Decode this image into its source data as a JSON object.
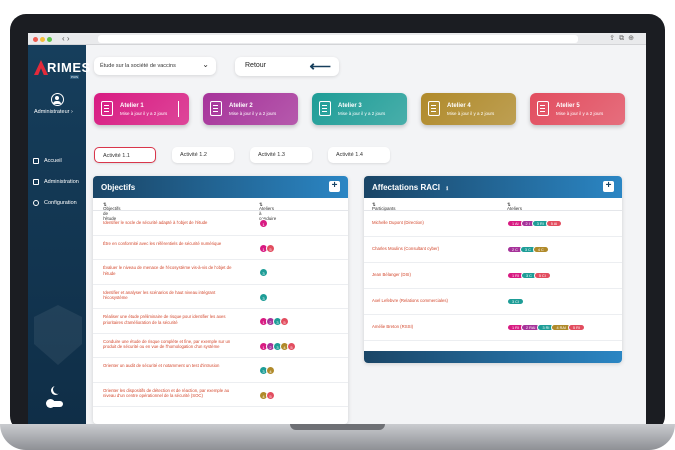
{
  "brand": {
    "name": "RIMES",
    "sub": "PUIS"
  },
  "colors": {
    "sidebar": "#163e5c",
    "accent": "#2b86c4",
    "danger": "#d9364b"
  },
  "sidebar": {
    "role": "Administrateur ›",
    "items": [
      {
        "label": "Accueil",
        "icon": "home-icon"
      },
      {
        "label": "Administration",
        "icon": "admin-icon"
      },
      {
        "label": "Configuration",
        "icon": "gear-icon"
      }
    ]
  },
  "study_select": {
    "value": "Étude sur la société de vaccins",
    "icon": "chevron-down-icon"
  },
  "back_button": {
    "label": "Retour",
    "icon": "arrow-left-icon"
  },
  "ateliers": [
    {
      "title": "Atelier 1",
      "subtitle": "Mise à jour il y a 2 jours",
      "color": "#d81b82"
    },
    {
      "title": "Atelier 2",
      "subtitle": "Mise à jour il y a 2 jours",
      "color": "#a6339a"
    },
    {
      "title": "Atelier 3",
      "subtitle": "Mise à jour il y a 2 jours",
      "color": "#1e9d97"
    },
    {
      "title": "Atelier 4",
      "subtitle": "Mise à jour il y a 2 jours",
      "color": "#b08a2a"
    },
    {
      "title": "Atelier 5",
      "subtitle": "Mise à jour il y a 2 jours",
      "color": "#e24d5f"
    }
  ],
  "activities": [
    "Activité 1.1",
    "Activité 1.2",
    "Activité 1.3",
    "Activité 1.4"
  ],
  "objectifs": {
    "title": "Objectifs",
    "col1": "Objectifs de l'étude",
    "col2": "Ateliers à conduire",
    "rows": [
      {
        "text": "Identifier le socle de sécurité adapté à l'objet de l'étude",
        "tags": [
          "1"
        ]
      },
      {
        "text": "Être en conformité avec les référentiels de sécurité numérique",
        "tags": [
          "1",
          "5"
        ]
      },
      {
        "text": "Évaluer le niveau de menace de l'écosystème vis-à-vis de l'objet de l'étude",
        "tags": [
          "3"
        ]
      },
      {
        "text": "Identifier et analyser les scénarios de haut niveau intégrant l'écosystème",
        "tags": [
          "3"
        ]
      },
      {
        "text": "Réaliser une étude préliminaire de risque pour identifier les axes prioritaires d'amélioration de la sécurité",
        "tags": [
          "1",
          "2",
          "3",
          "5"
        ]
      },
      {
        "text": "Conduire une étude de risque complète et fine, par exemple sur un produit de sécurité ou en vue de l'homologation d'un système",
        "tags": [
          "1",
          "2",
          "3",
          "4",
          "5"
        ]
      },
      {
        "text": "Orienter un audit de sécurité et notamment un test d'intrusion",
        "tags": [
          "3",
          "4"
        ]
      },
      {
        "text": "Orienter les dispositifs de détection et de réaction, par exemple au niveau d'un centre opérationnel de la sécurité (SOC)",
        "tags": [
          "4",
          "5"
        ]
      }
    ]
  },
  "raci": {
    "title": "Affectations RACI",
    "info_icon": "info-icon",
    "col1": "Participants",
    "col2": "Ateliers",
    "rows": [
      {
        "name": "Michelle Dupont (Direction)",
        "tags": [
          "1 AI",
          "2 I",
          "3 RI",
          "5 AI"
        ]
      },
      {
        "name": "Charles Moulins (Consultant cyber)",
        "tags": [
          "2 C",
          "3 C",
          "4 C"
        ]
      },
      {
        "name": "Jean Bélanger (DSI)",
        "tags": [
          "1 RI",
          "3 C",
          "5 CI"
        ]
      },
      {
        "name": "Axel Lefebvre (Relations commerciales)",
        "tags": [
          "3 CI"
        ]
      },
      {
        "name": "Amélie Breton (RSSI)",
        "tags": [
          "1 RI",
          "2 RAI",
          "3 RI",
          "4 RAI",
          "5 RI"
        ]
      }
    ]
  }
}
